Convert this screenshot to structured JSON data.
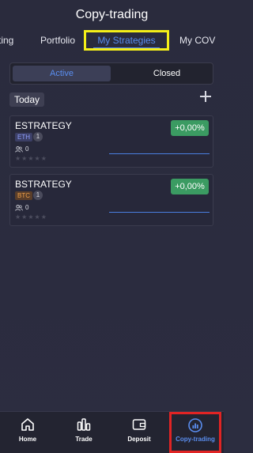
{
  "header": {
    "title": "Copy-trading"
  },
  "tabs": [
    {
      "label": "ting"
    },
    {
      "label": "Portfolio"
    },
    {
      "label": "My Strategies"
    },
    {
      "label": "My COV"
    }
  ],
  "segment": {
    "active_label": "Active",
    "closed_label": "Closed"
  },
  "section": {
    "date_label": "Today"
  },
  "strategies": [
    {
      "name": "ESTRATEGY",
      "asset": "ETH",
      "count": "1",
      "followers": "0",
      "change": "+0,00%",
      "rating": "★★★★★"
    },
    {
      "name": "BSTRATEGY",
      "asset": "BTC",
      "count": "1",
      "followers": "0",
      "change": "+0,00%",
      "rating": "★★★★★"
    }
  ],
  "bottom_nav": [
    {
      "label": "Home",
      "icon": "home-icon"
    },
    {
      "label": "Trade",
      "icon": "trade-bars-icon"
    },
    {
      "label": "Deposit",
      "icon": "wallet-icon"
    },
    {
      "label": "Copy-trading",
      "icon": "copy-trading-icon"
    }
  ],
  "colors": {
    "accent": "#5a8dee",
    "positive": "#3b9b62",
    "highlight_yellow": "#f5ef18",
    "highlight_red": "#e02424"
  }
}
